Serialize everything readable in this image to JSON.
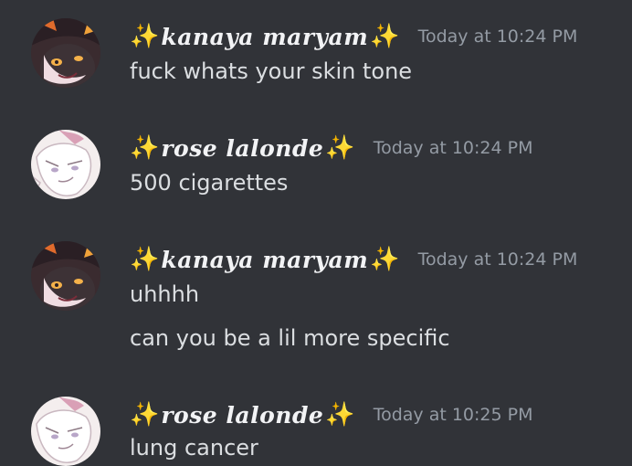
{
  "messages": [
    {
      "author": "kanaya maryam",
      "sparkle": "✨",
      "timestamp": "Today at 10:24 PM",
      "lines": [
        "fuck whats your skin tone"
      ]
    },
    {
      "author": "rose lalonde",
      "sparkle": "✨",
      "timestamp": "Today at 10:24 PM",
      "lines": [
        "500 cigarettes"
      ]
    },
    {
      "author": "kanaya maryam",
      "sparkle": "✨",
      "timestamp": "Today at 10:24 PM",
      "lines": [
        "uhhhh",
        "can you be a lil more specific"
      ]
    },
    {
      "author": "rose lalonde",
      "sparkle": "✨",
      "timestamp": "Today at 10:25 PM",
      "lines": [
        "lung cancer"
      ]
    }
  ],
  "colors": {
    "background": "#313338",
    "username": "#f2f3f5",
    "timestamp": "#949ba4",
    "text": "#dbdee1",
    "sparkle": "#f5c542"
  },
  "icons": {
    "sparkle": "sparkles-icon",
    "avatar_kanaya": "kanaya-avatar",
    "avatar_rose": "rose-avatar"
  }
}
